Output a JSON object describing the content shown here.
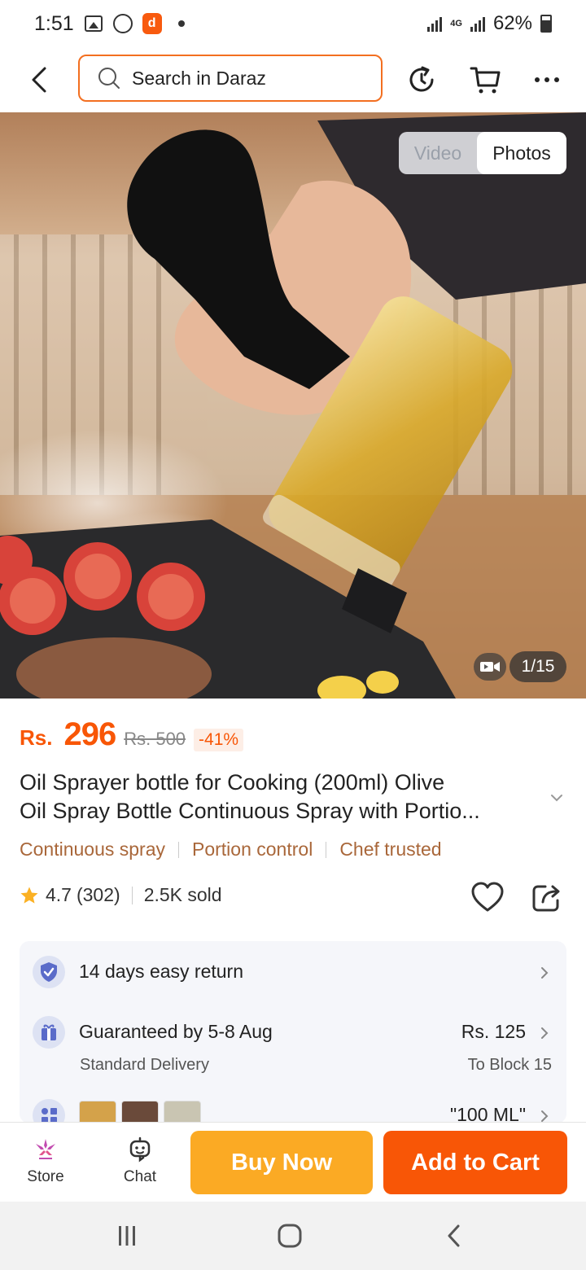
{
  "status_bar": {
    "time": "1:51",
    "network": "4G",
    "battery": "62%",
    "icons": [
      "gallery-icon",
      "whatsapp-icon",
      "daraz-app-icon",
      "notification-dot-icon",
      "signal-icon",
      "battery-icon"
    ]
  },
  "header": {
    "search_placeholder": "Search in Daraz",
    "icons": [
      "back-arrow-icon",
      "search-icon",
      "history-icon",
      "cart-icon",
      "more-icon"
    ]
  },
  "media": {
    "video_label": "Video",
    "photos_label": "Photos",
    "active_tab": "Photos",
    "counter": "1/15"
  },
  "price": {
    "currency": "Rs.",
    "current": "296",
    "original": "Rs. 500",
    "discount": "-41%"
  },
  "product": {
    "title_line1": "Oil Sprayer bottle for Cooking (200ml) Olive",
    "title_line2": "Oil Spray Bottle Continuous Spray with Portio...",
    "tags": [
      "Continuous spray",
      "Portion control",
      "Chef trusted"
    ]
  },
  "rating": {
    "score": "4.7",
    "count": "(302)",
    "sold": "2.5K sold"
  },
  "info": {
    "return_label": "14 days easy return",
    "delivery_label": "Guaranteed by 5-8 Aug",
    "delivery_sub": "Standard Delivery",
    "delivery_price": "Rs. 125",
    "delivery_location": "To Block 15",
    "variant_label": "\"100 ML\""
  },
  "bottom_bar": {
    "store_label": "Store",
    "chat_label": "Chat",
    "buy_now_label": "Buy Now",
    "add_to_cart_label": "Add to Cart"
  },
  "colors": {
    "brand_orange": "#f85606",
    "buy_now_yellow": "#fbaa24",
    "tag_brown": "#a9673a",
    "search_border": "#f36f20"
  }
}
